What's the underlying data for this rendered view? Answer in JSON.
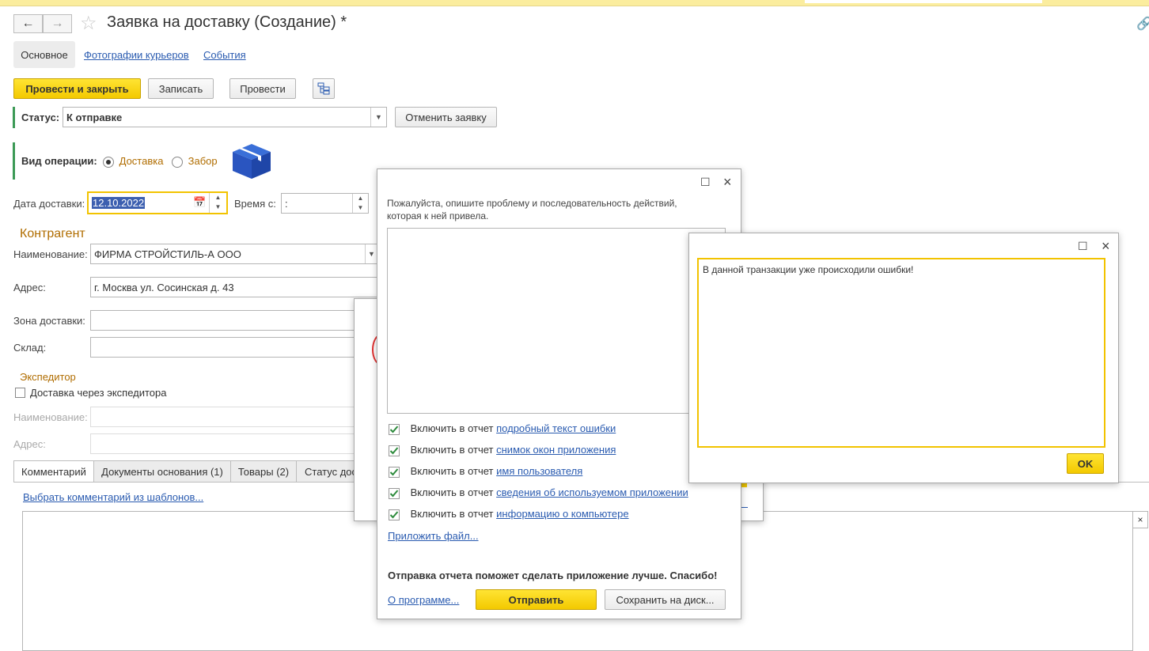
{
  "window": {
    "title": "Заявка на доставку (Создание) *"
  },
  "tabs_top": {
    "main": "Основное",
    "photos": "Фотографии курьеров",
    "events": "События"
  },
  "toolbar": {
    "post_close": "Провести и закрыть",
    "save": "Записать",
    "post": "Провести"
  },
  "status": {
    "label": "Статус:",
    "value": "К отправке",
    "cancel_button": "Отменить заявку"
  },
  "operation": {
    "label": "Вид операции:",
    "option1": "Доставка",
    "option2": "Забор",
    "selected": "Доставка"
  },
  "delivery": {
    "date_label": "Дата доставки:",
    "date_value": "12.10.2022",
    "time_label": "Время с:",
    "time_value": " :"
  },
  "counterparty": {
    "section": "Контрагент",
    "name_label": "Наименование:",
    "name_value": "ФИРМА СТРОЙСТИЛЬ-А ООО",
    "address_label": "Адрес:",
    "address_value": "г. Москва ул. Сосинская д. 43",
    "zone_label": "Зона доставки:",
    "zone_value": "",
    "warehouse_label": "Склад:",
    "warehouse_value": ""
  },
  "forwarder": {
    "section": "Экспедитор",
    "checkbox_label": "Доставка через экспедитора",
    "name_label": "Наименование:",
    "address_label": "Адрес:"
  },
  "bottom_tabs": [
    "Комментарий",
    "Документы основания (1)",
    "Товары (2)",
    "Статус дос"
  ],
  "comment": {
    "template_link": "Выбрать комментарий из шаблонов..."
  },
  "report_dialog": {
    "description": "Пожалуйста, опишите проблему и последовательность действий, которая к ней привела.",
    "include_prefix": "Включить в отчет",
    "items": [
      {
        "link": "подробный текст ошибки",
        "checked": true
      },
      {
        "link": "снимок окон приложения",
        "checked": true
      },
      {
        "link": "имя пользователя",
        "checked": true
      },
      {
        "link": "сведения об используемом приложении",
        "checked": true
      },
      {
        "link": "информацию о компьютере",
        "checked": true
      }
    ],
    "attach": "Приложить файл...",
    "thanks": "Отправка отчета поможет сделать приложение лучше. Спасибо!",
    "about": "О программе...",
    "send": "Отправить",
    "save_disk": "Сохранить на диск..."
  },
  "error_dialog": {
    "message": "В данной транзакции уже происходили ошибки!",
    "ok": "OK"
  },
  "colors": {
    "accent_yellow": "#f5cc00",
    "link_blue": "#2a5bb0",
    "section_orange": "#b06d00",
    "status_green": "#3c9a56"
  }
}
